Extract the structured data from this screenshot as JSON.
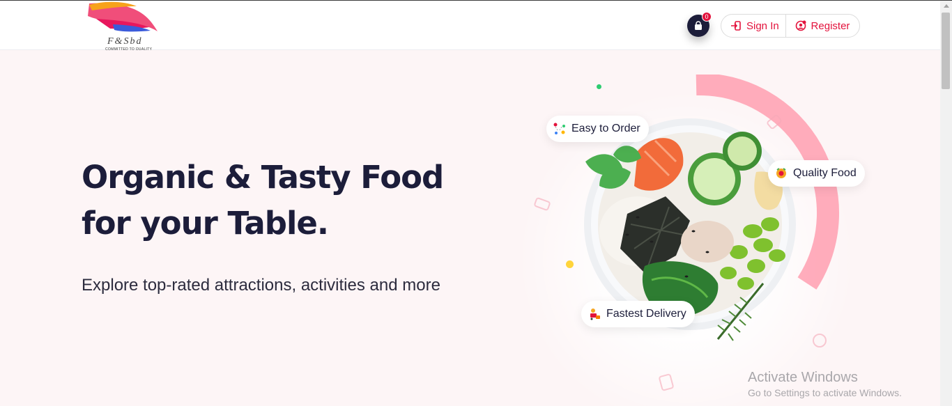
{
  "brand": {
    "name": "F&Sbd",
    "tagline": "COMMITTED TO QUALITY"
  },
  "header": {
    "cart_count": "0",
    "sign_in_label": "Sign In",
    "register_label": "Register"
  },
  "hero": {
    "title_line1": "Organic & Tasty Food",
    "title_line2": "for your Table.",
    "subtitle": "Explore top-rated attractions, activities and more"
  },
  "badges": {
    "easy": "Easy to Order",
    "quality": "Quality Food",
    "fast": "Fastest Delivery"
  },
  "watermark": {
    "title": "Activate Windows",
    "subtitle": "Go to Settings to activate Windows."
  },
  "icons": [
    "logo-wings",
    "shopping-bag-icon",
    "sign-in-icon",
    "register-icon",
    "order-icon",
    "quality-icon",
    "delivery-icon"
  ],
  "colors": {
    "accent": "#e3123c",
    "navy": "#1c1d3a",
    "hero_bg": "#fdf5f6",
    "ring": "#ff9fb0"
  }
}
